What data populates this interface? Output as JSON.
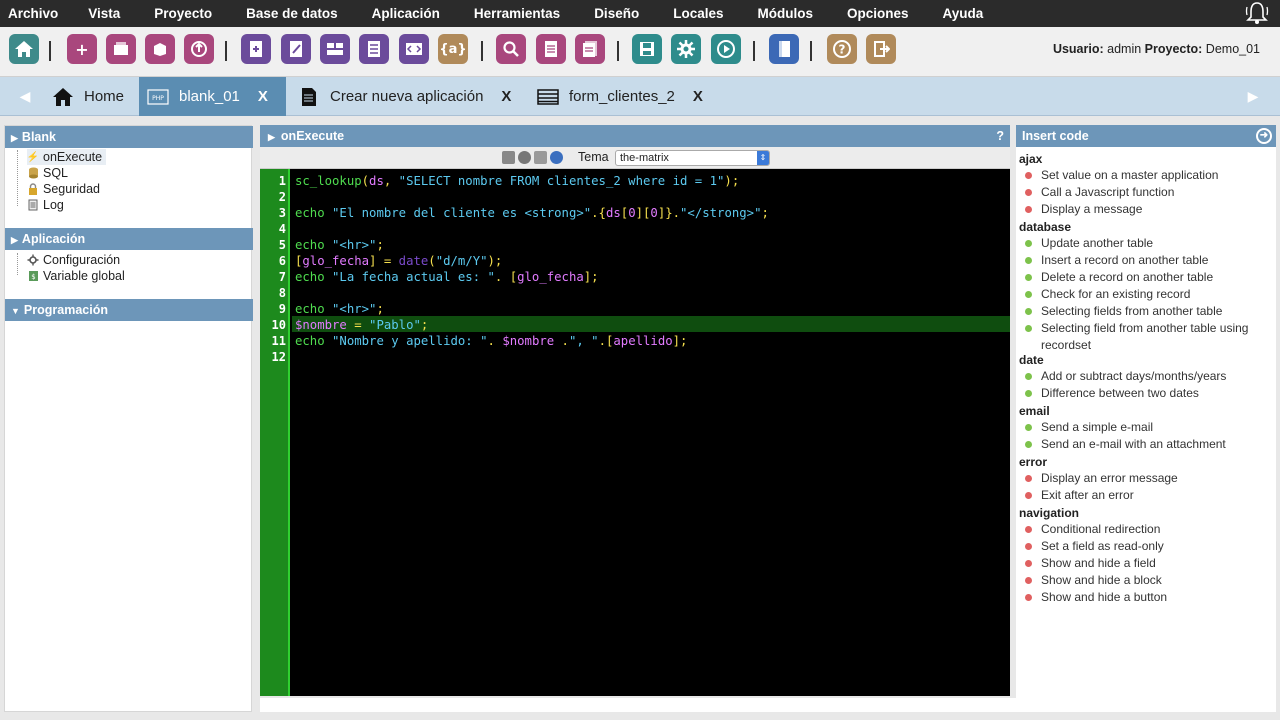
{
  "menu": [
    "Archivo",
    "Vista",
    "Proyecto",
    "Base de datos",
    "Aplicación",
    "Herramientas",
    "Diseño",
    "Locales",
    "Módulos",
    "Opciones",
    "Ayuda"
  ],
  "user": {
    "label1": "Usuario:",
    "user": "admin",
    "label2": "Proyecto:",
    "project": "Demo_01"
  },
  "tabs": [
    {
      "label": "Home"
    },
    {
      "label": "blank_01",
      "close": "X"
    },
    {
      "label": "Crear nueva aplicación",
      "close": "X"
    },
    {
      "label": "form_clientes_2",
      "close": "X"
    }
  ],
  "left": {
    "blank": {
      "title": "Blank",
      "items": [
        "onExecute",
        "SQL",
        "Seguridad",
        "Log"
      ]
    },
    "aplicacion": {
      "title": "Aplicación",
      "items": [
        "Configuración",
        "Variable global"
      ]
    },
    "programacion": {
      "title": "Programación"
    }
  },
  "editor": {
    "title": "onExecute",
    "help": "?",
    "theme_label": "Tema",
    "theme_value": "the-matrix",
    "line_numbers": [
      "1",
      "2",
      "3",
      "4",
      "5",
      "6",
      "7",
      "8",
      "9",
      "10",
      "11",
      "12"
    ]
  },
  "right": {
    "title": "Insert code",
    "categories": [
      {
        "name": "ajax",
        "items": [
          {
            "text": "Set value on a master application",
            "color": "red"
          },
          {
            "text": "Call a Javascript function",
            "color": "red"
          },
          {
            "text": "Display a message",
            "color": "red"
          }
        ]
      },
      {
        "name": "database",
        "items": [
          {
            "text": "Update another table",
            "color": "green"
          },
          {
            "text": "Insert a record on another table",
            "color": "green"
          },
          {
            "text": "Delete a record on another table",
            "color": "green"
          },
          {
            "text": "Check for an existing record",
            "color": "green"
          },
          {
            "text": "Selecting fields from another table",
            "color": "green"
          },
          {
            "text": "Selecting field from another table using recordset",
            "color": "green"
          }
        ]
      },
      {
        "name": "date",
        "items": [
          {
            "text": "Add or subtract days/months/years",
            "color": "green"
          },
          {
            "text": "Difference between two dates",
            "color": "green"
          }
        ]
      },
      {
        "name": "email",
        "items": [
          {
            "text": "Send a simple e-mail",
            "color": "green"
          },
          {
            "text": "Send an e-mail with an attachment",
            "color": "green"
          }
        ]
      },
      {
        "name": "error",
        "items": [
          {
            "text": "Display an error message",
            "color": "red"
          },
          {
            "text": "Exit after an error",
            "color": "red"
          }
        ]
      },
      {
        "name": "navigation",
        "items": [
          {
            "text": "Conditional redirection",
            "color": "red"
          },
          {
            "text": "Set a field as read-only",
            "color": "red"
          },
          {
            "text": "Show and hide a field",
            "color": "red"
          },
          {
            "text": "Show and hide a block",
            "color": "red"
          },
          {
            "text": "Show and hide a button",
            "color": "red"
          }
        ]
      }
    ]
  },
  "code": {
    "l1": [
      "sc_lookup",
      "(",
      "ds",
      ", ",
      "\"SELECT nombre FROM clientes_2 where id = 1\"",
      ");"
    ],
    "l3": [
      "echo ",
      "\"El nombre del cliente es <strong>\"",
      ".{",
      "ds",
      "[",
      "0",
      "][",
      "0",
      "]}.",
      "\"</strong>\"",
      ";"
    ],
    "l5": [
      "echo ",
      "\"<hr>\"",
      ";"
    ],
    "l6": [
      "[",
      "glo_fecha",
      "] = ",
      "date",
      "(",
      "\"d/m/Y\"",
      ");"
    ],
    "l7": [
      "echo ",
      "\"La fecha actual es: \"",
      ". [",
      "glo_fecha",
      "];"
    ],
    "l9": [
      "echo ",
      "\"<hr>\"",
      ";"
    ],
    "l10": [
      "$nombre",
      " = ",
      "\"Pablo\"",
      ";"
    ],
    "l11": [
      "echo ",
      "\"Nombre y apellido: \"",
      ". ",
      "$nombre",
      " .",
      "\", \"",
      ".[",
      "apellido",
      "];"
    ]
  },
  "colors": {
    "header": "#6d96b9",
    "active_tab": "#5b8db2",
    "gutter": "#1d8a1d"
  }
}
